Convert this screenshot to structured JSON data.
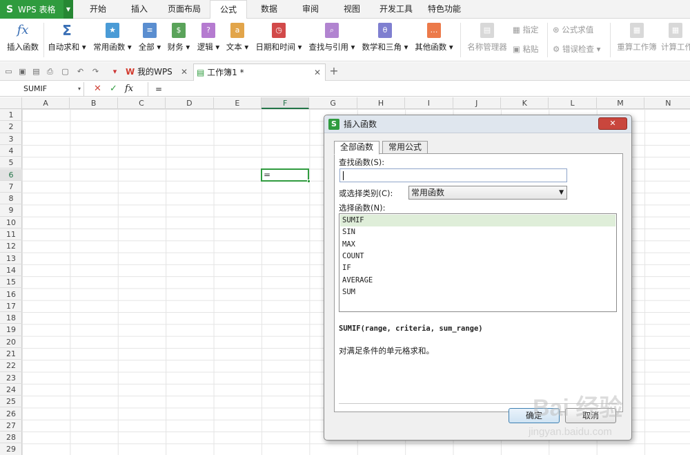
{
  "app": {
    "title": "WPS 表格"
  },
  "menu": {
    "tabs": [
      "开始",
      "插入",
      "页面布局",
      "公式",
      "数据",
      "审阅",
      "视图",
      "开发工具",
      "特色功能"
    ],
    "active": "公式"
  },
  "ribbon": {
    "buttons": [
      "插入函数",
      "自动求和",
      "常用函数",
      "全部",
      "财务",
      "逻辑",
      "文本",
      "日期和时间",
      "查找与引用",
      "数学和三角",
      "其他函数",
      "名称管理器"
    ],
    "small": {
      "define": "指定",
      "paste": "粘贴",
      "eval": "公式求值",
      "error_check": "错误检查",
      "recalc_book": "重算工作簿",
      "calc_sheet": "计算工作"
    }
  },
  "doctabs": {
    "home": "我的WPS",
    "workbook": "工作簿1 *"
  },
  "formula_bar": {
    "name_box": "SUMIF",
    "fx": "fx",
    "value": "="
  },
  "grid": {
    "columns": [
      "A",
      "B",
      "C",
      "D",
      "E",
      "F",
      "G",
      "H",
      "I",
      "J",
      "K",
      "L",
      "M",
      "N"
    ],
    "rows": [
      "1",
      "2",
      "3",
      "4",
      "5",
      "6",
      "7",
      "8",
      "9",
      "10",
      "11",
      "12",
      "13",
      "14",
      "15",
      "16",
      "17",
      "18",
      "19",
      "20",
      "21",
      "22",
      "23",
      "24",
      "25",
      "26",
      "27",
      "28",
      "29"
    ],
    "active_cell_value": "="
  },
  "dialog": {
    "title": "插入函数",
    "tabs": [
      "全部函数",
      "常用公式"
    ],
    "search_label": "查找函数(S):",
    "search_value": "",
    "category_label": "或选择类别(C):",
    "category_value": "常用函数",
    "list_label": "选择函数(N):",
    "functions": [
      "SUMIF",
      "SIN",
      "MAX",
      "COUNT",
      "IF",
      "AVERAGE",
      "SUM"
    ],
    "signature": "SUMIF(range, criteria, sum_range)",
    "description": "对满足条件的单元格求和。",
    "ok": "确定",
    "cancel": "取消"
  },
  "watermark": {
    "text": "Bai 经验",
    "url": "jingyan.baidu.com"
  }
}
